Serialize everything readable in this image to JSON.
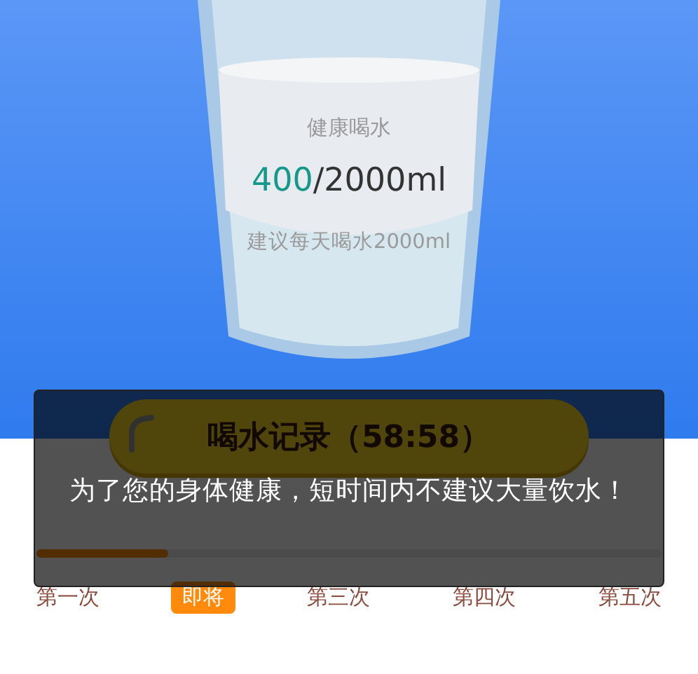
{
  "header": {
    "title": "健康喝水",
    "intake": "400",
    "goal": "/2000ml",
    "hint": "建议每天喝水2000ml"
  },
  "record_button": {
    "label": "喝水记录（58:58）"
  },
  "progress": {
    "level": 0.21
  },
  "steps": [
    {
      "label": "第一次",
      "selected": false
    },
    {
      "label": "即将",
      "selected": true
    },
    {
      "label": "第三次",
      "selected": false
    },
    {
      "label": "第四次",
      "selected": false
    },
    {
      "label": "第五次",
      "selected": false
    }
  ],
  "toast": {
    "message": "为了您的身体健康，短时间内不建议大量饮水！"
  }
}
